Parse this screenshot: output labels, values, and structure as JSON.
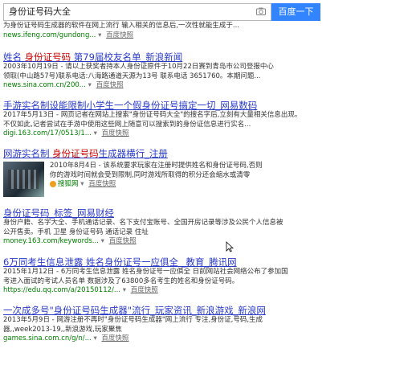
{
  "search": {
    "query": "身份证号码大全",
    "button_label": "百度一下"
  },
  "results": [
    {
      "snippet_top": "为身份证号码生成器的软件在网上流行 输入相关的信息后,一次性就能生成于...",
      "url": "news.ifeng.com/gundong...",
      "snap": "百度快照"
    },
    {
      "title_pre": "姓名 ",
      "title_em": "身份证号码",
      "title_post": " 第79届校友名单_新浪新闻",
      "line1": "2003年10月19日 - 请以上获奖者持本人身份证原件于10月22日赛到青岛市公司登报中心",
      "line2": "领取(中山路57号)联系电话:八海路通道天源为13号 联系电话 3651760。本期问题...",
      "url": "news.sina.com.cn/200...",
      "snap": "百度快照"
    },
    {
      "title_pre": "手游实名制设能限制小学生一个假身份证号搞定一切_网易数码",
      "line1": "2017年5月13日 - 网页记者在网站上搜索\"身份证号码大全\"的搜名字后,立刻有大量相关信息出现。",
      "line2": "不仅如此,记者尝试在手游中使用这些网上随意可以搜索到的身份证信息进行实名...",
      "url": "digi.163.com/17/0513/1...",
      "snap": "百度快照"
    },
    {
      "title_pre": "网游实名制 ",
      "title_em": "身份证号码",
      "title_post": "生成器横行_注册",
      "line1": "2010年8月4日 - 该系统要求玩家在注册时提供姓名和身份证号码,否则",
      "line2": "你的游戏时间就会受到限制,同时游戏所取得的积分还会缩水或清零",
      "source": "搜狐网",
      "snap": "百度快照"
    },
    {
      "title_pre": "身份证号码_标签_网易财经",
      "line1": "身份户籍、名字大全、手机通话记录、名下支付宝账号、全国开房记录等涉及公民个人信息被",
      "line2": "公开售卖。手机 卫星 身份证号码 通话记录 住址",
      "url": "money.163.com/keywords...",
      "snap": "百度快照"
    },
    {
      "title_pre": "6万同考生信息泄露 姓名身份证号一应俱全 _教育_腾讯网",
      "line1": "2015年1月12日 - 6万同考生信息泄露 姓名身份证号一应俱全 日前网站社会网络公布了参加国",
      "line2": "考进入面试的考试人员名单 数据涉及了63800多名考生的姓名和身份证号码。",
      "url": "https://edu.qq.com/a/20150112/...",
      "snap": "百度快照"
    },
    {
      "title_pre": "一次成多号\"身份证号码生成器\"流行_玩家资讯_新浪游戏_新浪网",
      "line1": "2013年5月9日 - 网游注册不再时\"身份证号码生成器\"网上流行 专注,身份证,号码,生成",
      "line2": "器,,week2013-19,,新浪游戏,玩家聚焦",
      "url": "games.sina.com.cn/g/n/...",
      "snap": "百度快照"
    }
  ]
}
